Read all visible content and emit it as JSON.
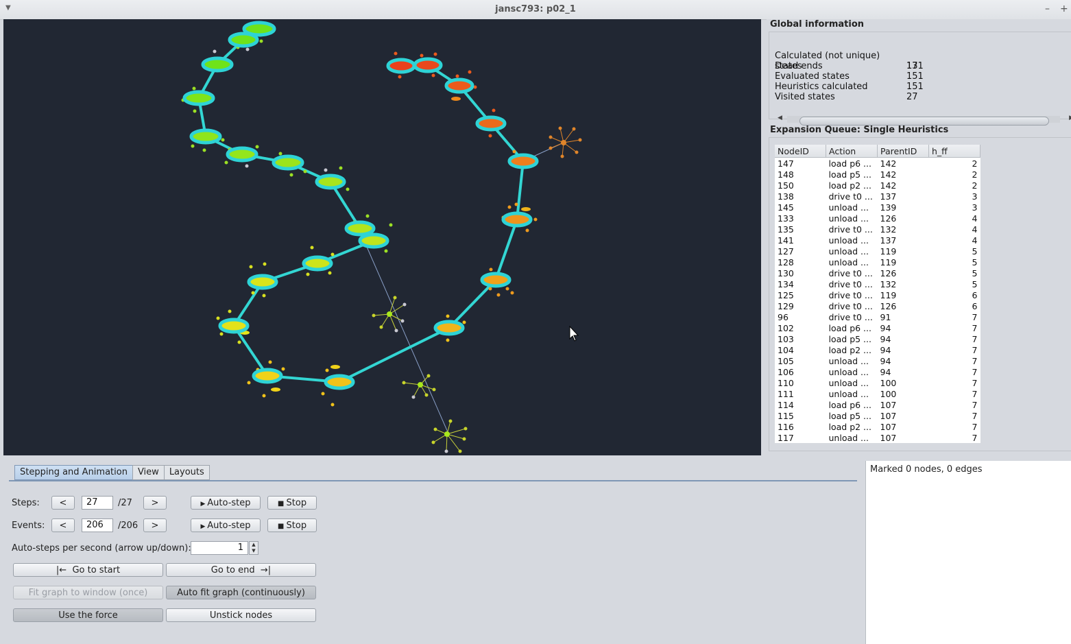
{
  "window": {
    "title": "jansc793: p02_1"
  },
  "global_info": {
    "title": "Global information",
    "stats": [
      {
        "label": "Calculated (not unique) states",
        "value": "171"
      },
      {
        "label": "Dead ends",
        "value": "13"
      },
      {
        "label": "Evaluated states",
        "value": "151"
      },
      {
        "label": "Heuristics calculated",
        "value": "151"
      },
      {
        "label": "Visited states",
        "value": "27"
      }
    ]
  },
  "queue": {
    "title": "Expansion Queue: Single Heuristics",
    "columns": [
      "NodeID",
      "Action",
      "ParentID",
      "h_ff"
    ],
    "rows": [
      [
        "147",
        "load p6 ...",
        "142",
        "2"
      ],
      [
        "148",
        "load p5 ...",
        "142",
        "2"
      ],
      [
        "150",
        "load p2 ...",
        "142",
        "2"
      ],
      [
        "138",
        "drive t0 ...",
        "137",
        "3"
      ],
      [
        "145",
        "unload ...",
        "139",
        "3"
      ],
      [
        "133",
        "unload ...",
        "126",
        "4"
      ],
      [
        "135",
        "drive t0 ...",
        "132",
        "4"
      ],
      [
        "141",
        "unload ...",
        "137",
        "4"
      ],
      [
        "127",
        "unload ...",
        "119",
        "5"
      ],
      [
        "128",
        "unload ...",
        "119",
        "5"
      ],
      [
        "130",
        "drive t0 ...",
        "126",
        "5"
      ],
      [
        "134",
        "drive t0 ...",
        "132",
        "5"
      ],
      [
        "125",
        "drive t0 ...",
        "119",
        "6"
      ],
      [
        "129",
        "drive t0 ...",
        "126",
        "6"
      ],
      [
        "96",
        "drive t0 ...",
        "91",
        "7"
      ],
      [
        "102",
        "load p6 ...",
        "94",
        "7"
      ],
      [
        "103",
        "load p5 ...",
        "94",
        "7"
      ],
      [
        "104",
        "load p2 ...",
        "94",
        "7"
      ],
      [
        "105",
        "unload ...",
        "94",
        "7"
      ],
      [
        "106",
        "unload ...",
        "94",
        "7"
      ],
      [
        "110",
        "unload ...",
        "100",
        "7"
      ],
      [
        "111",
        "unload ...",
        "100",
        "7"
      ],
      [
        "114",
        "load p6 ...",
        "107",
        "7"
      ],
      [
        "115",
        "load p5 ...",
        "107",
        "7"
      ],
      [
        "116",
        "load p2 ...",
        "107",
        "7"
      ],
      [
        "117",
        "unload ...",
        "107",
        "7"
      ]
    ]
  },
  "tabs": [
    "Stepping and Animation",
    "View",
    "Layouts"
  ],
  "controls": {
    "steps_label": "Steps:",
    "steps_value": "27",
    "steps_total": "/27",
    "events_label": "Events:",
    "events_value": "206",
    "events_total": "/206",
    "prev": "<",
    "next": ">",
    "autostep": "Auto-step",
    "stop": "Stop",
    "rate_label": "Auto-steps per second (arrow up/down):",
    "rate_value": "1",
    "go_start": "Go to start",
    "go_end": "Go to end",
    "fit_once": "Fit graph to window (once)",
    "auto_fit": "Auto fit graph (continuously)",
    "use_force": "Use the force",
    "unstick": "Unstick nodes"
  },
  "marked": "Marked 0 nodes, 0 edges",
  "colors": {
    "graph_bg": "#212733",
    "edge": "#33d6d3",
    "node_ring": "#2ed3d6"
  }
}
